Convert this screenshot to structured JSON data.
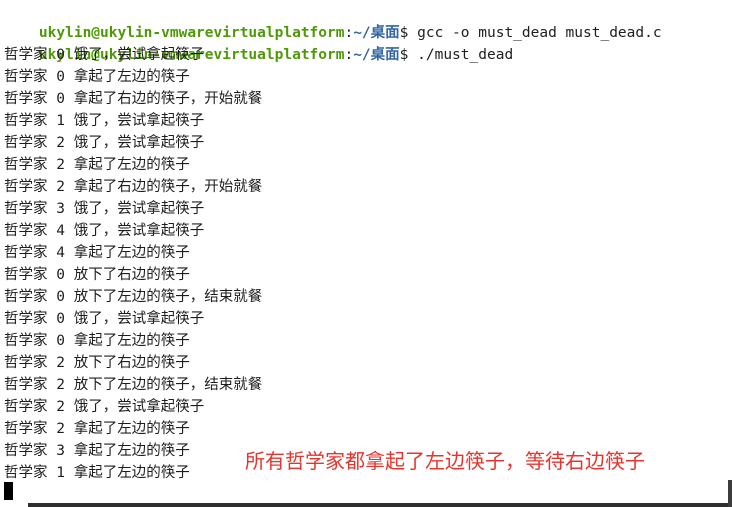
{
  "terminal": {
    "prompt": {
      "user_host": "ukylin@ukylin-vmwarevirtualplatform",
      "separator": ":",
      "path": "~/桌面",
      "symbol": "$ "
    },
    "commands": [
      "gcc -o must_dead must_dead.c",
      "./must_dead"
    ],
    "output": [
      "哲学家 0 饿了，尝试拿起筷子",
      "哲学家 0 拿起了左边的筷子",
      "哲学家 0 拿起了右边的筷子，开始就餐",
      "哲学家 1 饿了，尝试拿起筷子",
      "哲学家 2 饿了，尝试拿起筷子",
      "哲学家 2 拿起了左边的筷子",
      "哲学家 2 拿起了右边的筷子，开始就餐",
      "哲学家 3 饿了，尝试拿起筷子",
      "哲学家 4 饿了，尝试拿起筷子",
      "哲学家 4 拿起了左边的筷子",
      "哲学家 0 放下了右边的筷子",
      "哲学家 0 放下了左边的筷子，结束就餐",
      "哲学家 0 饿了，尝试拿起筷子",
      "哲学家 0 拿起了左边的筷子",
      "哲学家 2 放下了右边的筷子",
      "哲学家 2 放下了左边的筷子，结束就餐",
      "哲学家 2 饿了，尝试拿起筷子",
      "哲学家 2 拿起了左边的筷子",
      "哲学家 3 拿起了左边的筷子",
      "哲学家 1 拿起了左边的筷子"
    ]
  },
  "annotation": {
    "text": "所有哲学家都拿起了左边筷子，等待右边筷子",
    "color": "#e8342c"
  },
  "colors": {
    "prompt_user": "#4e9a06",
    "prompt_path": "#3465a4",
    "text": "#1e1e1e",
    "background": "#ffffff"
  }
}
